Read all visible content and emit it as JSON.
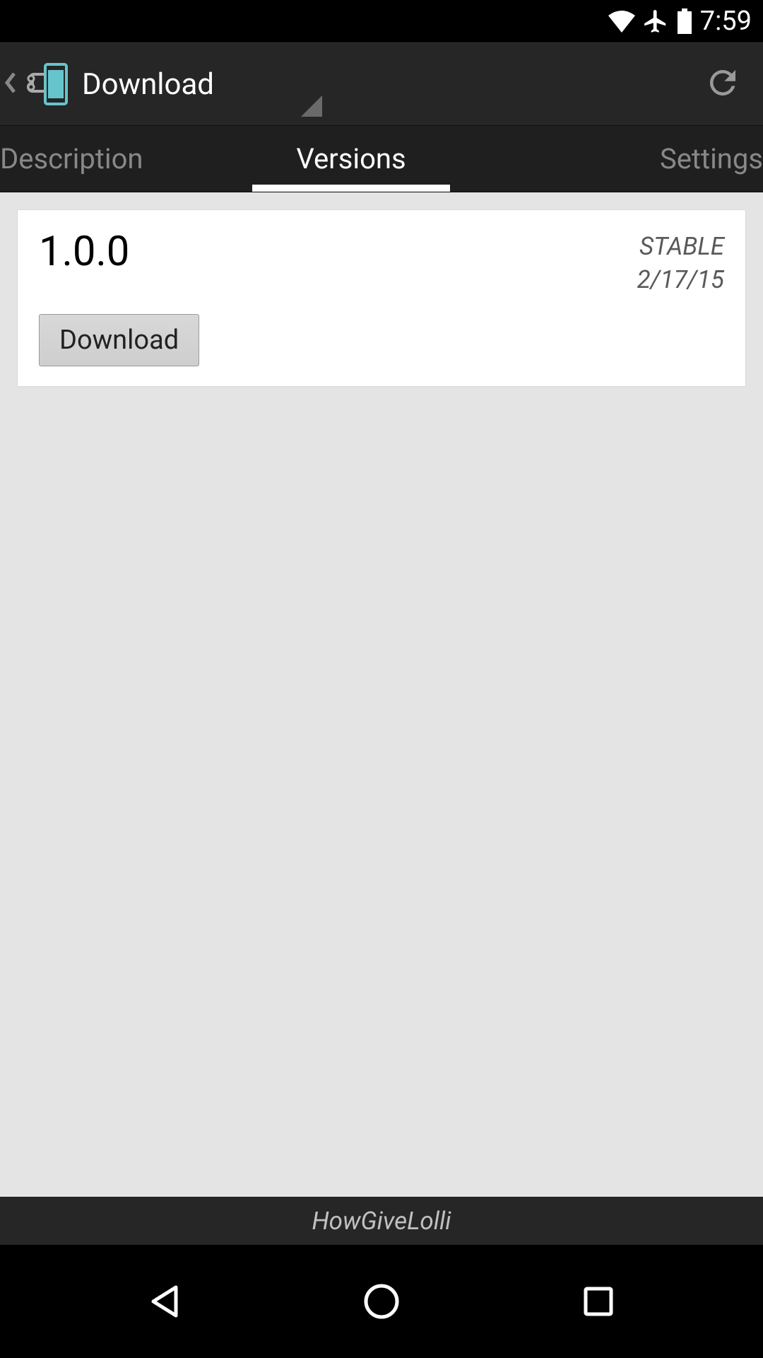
{
  "status": {
    "time": "7:59"
  },
  "actionbar": {
    "title": "Download"
  },
  "tabs": {
    "description": "Description",
    "versions": "Versions",
    "settings": "Settings"
  },
  "card": {
    "version": "1.0.0",
    "channel": "STABLE",
    "date": "2/17/15",
    "button_label": "Download"
  },
  "footer": {
    "label": "HowGiveLolli"
  }
}
